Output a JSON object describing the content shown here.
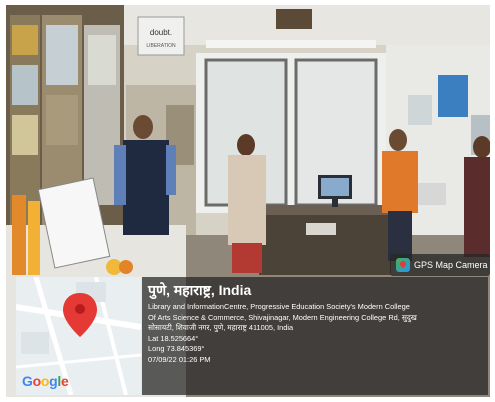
{
  "badge": {
    "label": "GPS Map Camera",
    "icon": "gps-map-camera-icon"
  },
  "map": {
    "pin_icon": "location-pin-icon",
    "logo": "Google"
  },
  "location": {
    "title": "पुणे, महाराष्ट्र, India",
    "address_line1": "Library and InformationCentre, Progressive Education Society's Modern College",
    "address_line2": "Of Arts Science & Commerce, Shivajinagar, Modern Engineering College Rd, सुदुख",
    "address_line3": "सोसायटी, शिवाजी नगर, पुणे, महाराष्ट्र 411005, India",
    "lat": "Lat 18.525664°",
    "long": "Long 73.845369°",
    "datetime": "07/09/22 01:26 PM"
  },
  "photo_text": {
    "sign": "doubt.",
    "sign_sub": "LIBERATION"
  },
  "colors": {
    "pin": "#e53935",
    "overlay": "#232323",
    "accent_orange": "#e07a2a"
  }
}
